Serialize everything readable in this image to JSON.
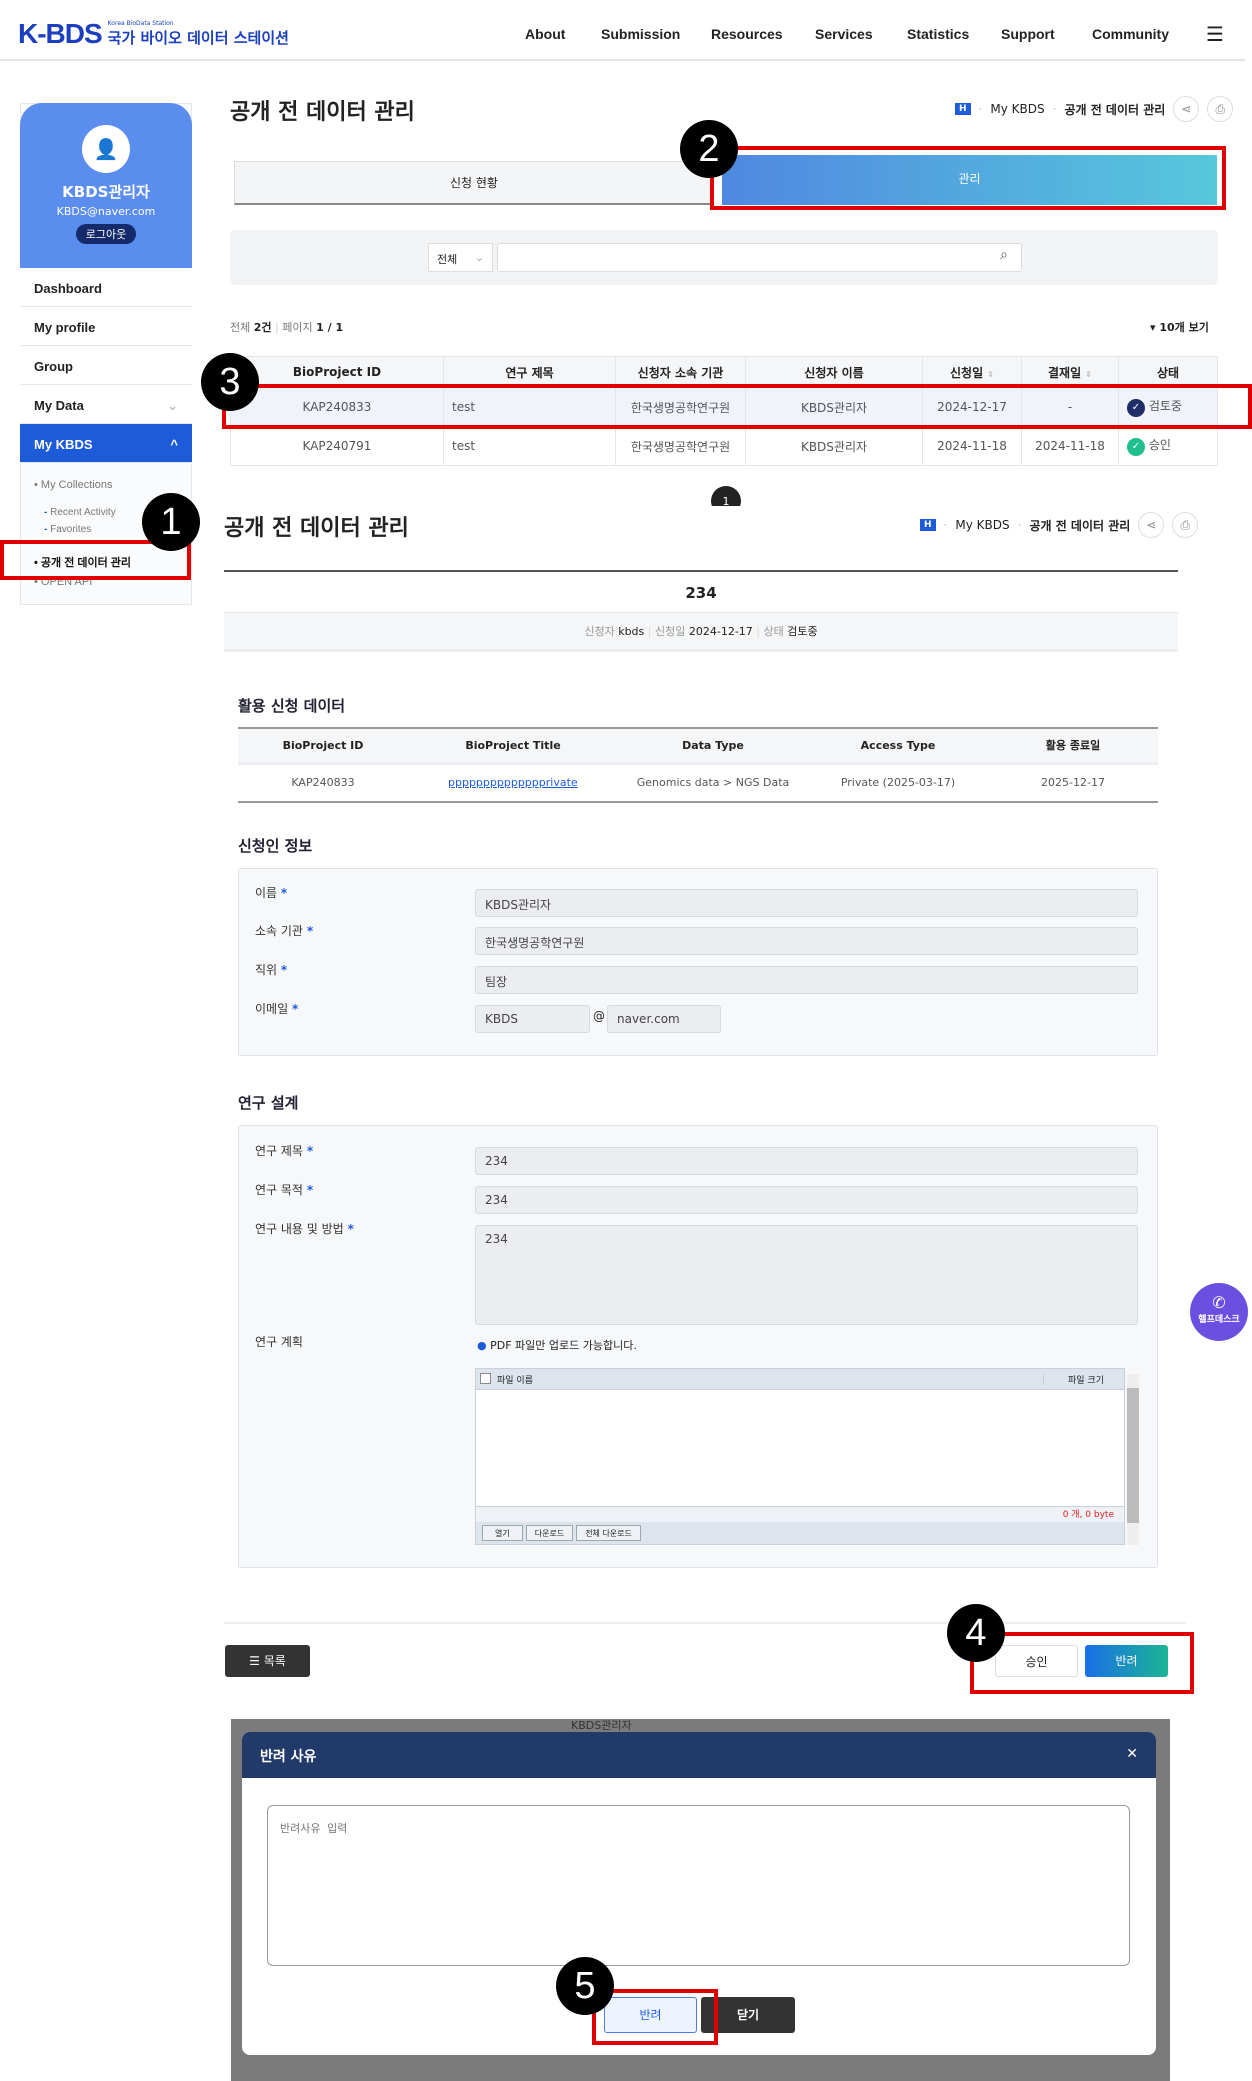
{
  "header": {
    "logo_small": "Korea BioData Station",
    "logo_mark": "K-BDS",
    "logo_kr": "국가 바이오 데이터 스테이션",
    "nav": [
      "About",
      "Submission",
      "Resources",
      "Services",
      "Statistics",
      "Support",
      "Community"
    ]
  },
  "sidebar": {
    "user": "KBDS관리자",
    "email": "KBDS@naver.com",
    "logout": "로그아웃",
    "items": [
      "Dashboard",
      "My profile",
      "Group",
      "My Data",
      "My KBDS"
    ],
    "sub": [
      "My Collections",
      "Recent Activity",
      "Favorites",
      "공개 전 데이터 관리",
      "OPEN API"
    ]
  },
  "page1": {
    "title": "공개 전 데이터 관리",
    "breadcrumb": [
      "H",
      "My KBDS",
      "공개 전 데이터 관리"
    ],
    "tabs": [
      "신청 현황",
      "관리"
    ],
    "search_select": "전체",
    "search_placeholder": "",
    "count_label": "전체",
    "count": "2건",
    "page_label": "페이지",
    "page": "1 / 1",
    "per_page": "10개 보기",
    "columns": [
      "BioProject ID",
      "연구 제목",
      "신청자 소속 기관",
      "신청자 이름",
      "신청일",
      "결재일",
      "상태"
    ],
    "rows": [
      [
        "KAP240833",
        "test",
        "한국생명공학연구원",
        "KBDS관리자",
        "2024-12-17",
        "-",
        "검토중"
      ],
      [
        "KAP240791",
        "test",
        "한국생명공학연구원",
        "KBDS관리자",
        "2024-11-18",
        "2024-11-18",
        "승인"
      ]
    ],
    "pagination": "1"
  },
  "page2": {
    "title": "공개 전 데이터 관리",
    "breadcrumb": [
      "H",
      "My KBDS",
      "공개 전 데이터 관리"
    ],
    "heading": "234",
    "meta": [
      [
        "신청자",
        "kbds"
      ],
      [
        "신청일",
        "2024-12-17"
      ],
      [
        "상태",
        "검토중"
      ]
    ],
    "data_section": "활용 신청 데이터",
    "data_columns": [
      "BioProject ID",
      "BioProject Title",
      "Data Type",
      "Access Type",
      "활용 종료일"
    ],
    "data_row": [
      "KAP240833",
      "pppppppppppppprivate",
      "Genomics data > NGS Data",
      "Private (2025-03-17)",
      "2025-12-17"
    ],
    "applicant_section": "신청인 정보",
    "applicant": {
      "name_label": "이름",
      "name": "KBDS관리자",
      "org_label": "소속 기관",
      "org": "한국생명공학연구원",
      "pos_label": "직위",
      "pos": "팀장",
      "email_label": "이메일",
      "email_user": "KBDS",
      "at": "@",
      "email_domain": "naver.com"
    },
    "design_section": "연구 설계",
    "design": {
      "title_label": "연구 제목",
      "title": "234",
      "purpose_label": "연구 목적",
      "purpose": "234",
      "content_label": "연구 내용 및 방법",
      "content": "234",
      "plan_label": "연구 계획",
      "plan_note": "PDF 파일만 업로드 가능합니다.",
      "file_col_name": "파일 이름",
      "file_col_size": "파일 크기",
      "file_summary": "0 개, 0 byte",
      "file_buttons": [
        "열기",
        "다운로드",
        "전체 다운로드"
      ]
    },
    "list_button": "목록",
    "approve_button": "승인",
    "reject_button": "반려",
    "helpdesk": "헬프데스크"
  },
  "modal": {
    "title": "반려 사유",
    "placeholder": "반려사유 입력",
    "reject": "반려",
    "close": "닫기",
    "bg_text": "KBDS관리자"
  },
  "steps": [
    "1",
    "2",
    "3",
    "4",
    "5"
  ],
  "colors": {
    "brand": "#1e5bd8",
    "modal_header": "#213a69",
    "helpdesk": "#6b4fe0",
    "highlight": "#e00000"
  }
}
